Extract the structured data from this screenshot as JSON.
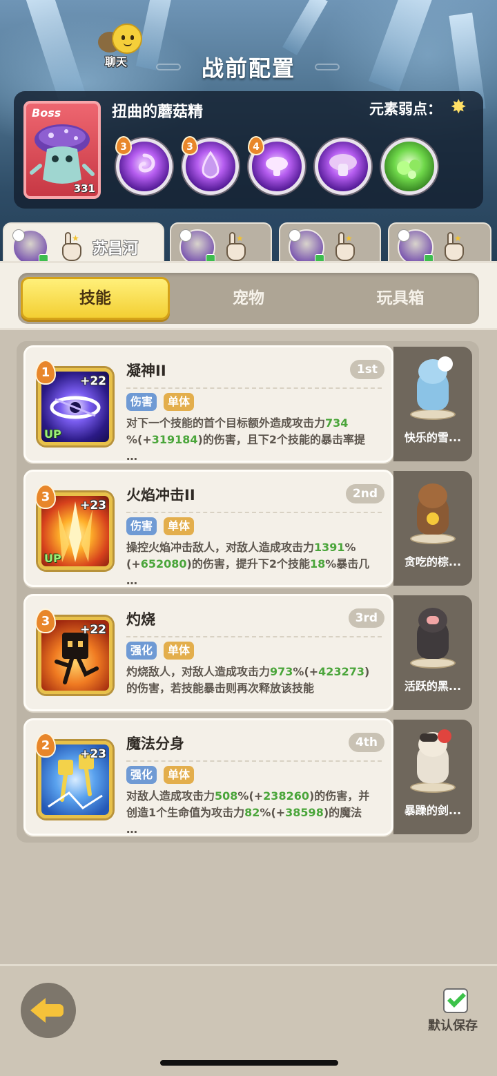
{
  "header": {
    "chat_label": "聊天",
    "title": "战前配置"
  },
  "boss": {
    "tag": "Boss",
    "level": "331",
    "name": "扭曲的蘑菇精",
    "weakness_label": "元素弱点：",
    "weakness_icon": "light-element-icon",
    "skills": [
      {
        "level": "3",
        "icon": "purple-swirl-icon"
      },
      {
        "level": "3",
        "icon": "purple-drop-icon"
      },
      {
        "level": "4",
        "icon": "glowing-mushroom-icon"
      },
      {
        "level": "",
        "icon": "mushroom-icon"
      },
      {
        "level": "",
        "icon": "green-slime-icon"
      }
    ]
  },
  "heroes": [
    {
      "name": "苏昌河",
      "active": true
    },
    {
      "name": "",
      "active": false
    },
    {
      "name": "",
      "active": false
    },
    {
      "name": "",
      "active": false
    }
  ],
  "tabs": [
    "技能",
    "宠物",
    "玩具箱"
  ],
  "active_tab": 0,
  "skills": [
    {
      "name": "凝神II",
      "order": "1st",
      "level": "1",
      "plus": "+22",
      "up": "UP",
      "tags": [
        "伤害",
        "单体"
      ],
      "lines": [
        [
          "对下一个技能的首个目标额外造成攻击力",
          "734"
        ],
        [
          "%(+",
          "319184",
          ")的伤害，且下2个技能的暴击率提"
        ],
        [
          "…"
        ]
      ],
      "pet_name": "快乐的雪..."
    },
    {
      "name": "火焰冲击II",
      "order": "2nd",
      "level": "3",
      "plus": "+23",
      "up": "UP",
      "tags": [
        "伤害",
        "单体"
      ],
      "lines": [
        [
          "操控火焰冲击敌人，对敌人造成攻击力",
          "1391",
          "%"
        ],
        [
          "(+",
          "652080",
          ")的伤害，提升下2个技能",
          "18",
          "%暴击几"
        ],
        [
          "…"
        ]
      ],
      "pet_name": "贪吃的棕..."
    },
    {
      "name": "灼烧",
      "order": "3rd",
      "level": "3",
      "plus": "+22",
      "up": "",
      "tags": [
        "强化",
        "单体"
      ],
      "lines": [
        [
          "灼烧敌人，对敌人造成攻击力",
          "973",
          "%(+",
          "423273",
          ")"
        ],
        [
          "的伤害，若技能暴击则再次释放该技能"
        ]
      ],
      "pet_name": "活跃的黑..."
    },
    {
      "name": "魔法分身",
      "order": "4th",
      "level": "2",
      "plus": "+23",
      "up": "",
      "tags": [
        "强化",
        "单体"
      ],
      "lines": [
        [
          "对敌人造成攻击力",
          "508",
          "%(+",
          "238260",
          ")的伤害，并"
        ],
        [
          "创造1个生命值为攻击力",
          "82",
          "%(+",
          "38598",
          ")的魔法"
        ],
        [
          "…"
        ]
      ],
      "pet_name": "暴躁的剑..."
    }
  ],
  "footer": {
    "save_label": "默认保存",
    "save_checked": true
  }
}
